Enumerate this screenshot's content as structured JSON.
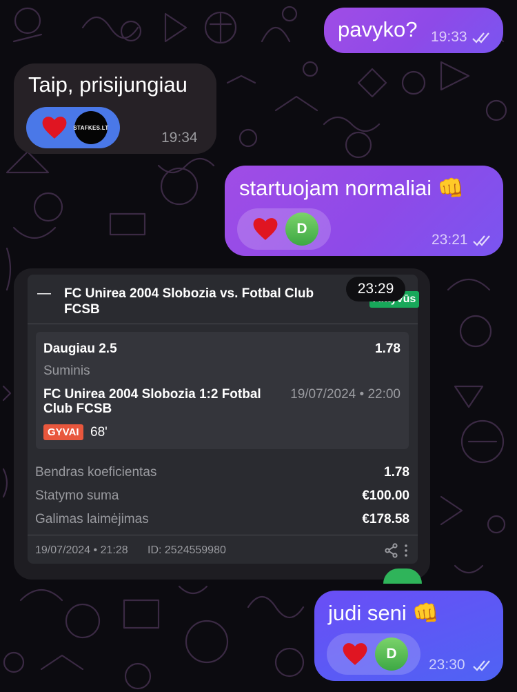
{
  "messages": {
    "m1": {
      "text": "pavyko?",
      "time": "19:33"
    },
    "m2": {
      "text": "Taip, prisijungiau",
      "time": "19:34",
      "reaction_user_logo": "STAFKES.LT"
    },
    "m3": {
      "text": "startuojam normaliai 👊",
      "time": "23:21",
      "reaction_user_initial": "D"
    },
    "m4": {
      "text": "judi seni 👊",
      "time": "23:30",
      "reaction_user_initial": "D"
    }
  },
  "bet": {
    "collapse_icon": "—",
    "match_title_line1": "FC Unirea 2004 Slobozia vs. Fotbal Club",
    "match_title_line2": "FCSB",
    "status": "Aktyvūs",
    "selection": "Daugiau 2.5",
    "selection_odds": "1.78",
    "market": "Suminis",
    "event_line1": "FC Unirea 2004 Slobozia 1:2 Fotbal",
    "event_line2": "Club FCSB",
    "event_datetime": "19/07/2024 • 22:00",
    "live_label": "GYVAI",
    "live_minute": "68'",
    "total_odds_label": "Bendras koeficientas",
    "total_odds": "1.78",
    "stake_label": "Statymo suma",
    "stake": "€100.00",
    "potential_win_label": "Galimas laimėjimas",
    "potential_win": "€178.58",
    "placed_at": "19/07/2024 • 21:28",
    "bet_id": "ID: 2524559980",
    "share_icon": "share-icon",
    "more_icon": "more-vertical-icon"
  },
  "bet_message_time": "23:29",
  "colors": {
    "outgoing_bubble": "#9a4ce8",
    "outgoing_bubble_blue": "#5a5cf5",
    "incoming_bubble": "#262126",
    "status_badge": "#18a85a",
    "live_badge": "#e8573d",
    "reaction_avatar": "#4caf50"
  }
}
